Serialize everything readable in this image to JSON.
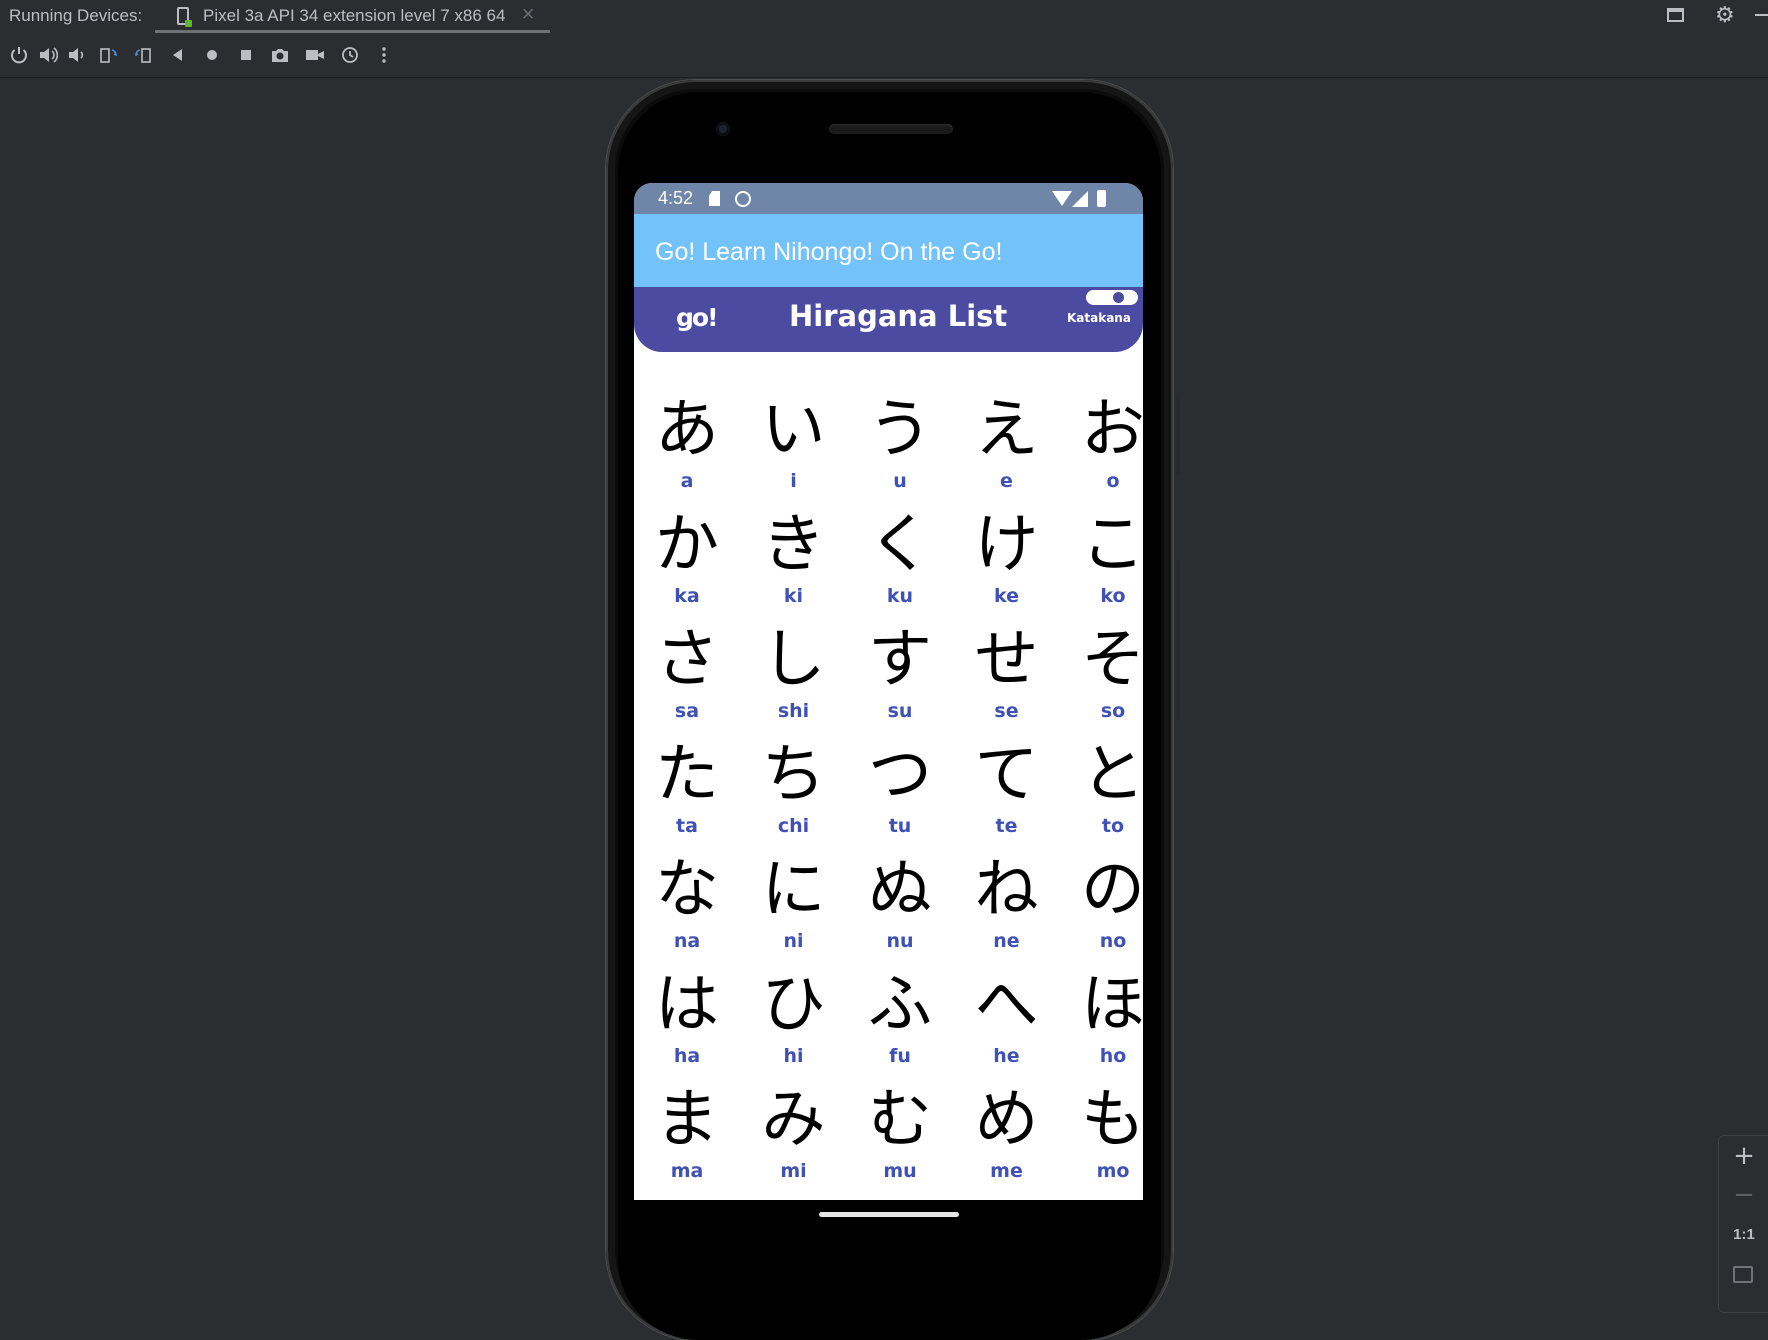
{
  "ide": {
    "running_label": "Running Devices:",
    "device_tab": "Pixel 3a API 34 extension level 7 x86 64",
    "tab_close": "×",
    "toolbar_icons": [
      "power-icon",
      "volume-up-icon",
      "volume-down-icon",
      "rotate-left-icon",
      "rotate-right-icon",
      "back-icon",
      "home-icon",
      "overview-icon",
      "screenshot-icon",
      "screen-record-icon",
      "snapshot-icon",
      "more-icon"
    ]
  },
  "status": {
    "time": "4:52"
  },
  "app": {
    "title": "Go! Learn Nihongo! On the Go!",
    "logo": "go!",
    "header_title": "Hiragana List",
    "toggle_label": "Katakana"
  },
  "kana": [
    [
      {
        "char": "あ",
        "roma": "a"
      },
      {
        "char": "い",
        "roma": "i"
      },
      {
        "char": "う",
        "roma": "u"
      },
      {
        "char": "え",
        "roma": "e"
      },
      {
        "char": "お",
        "roma": "o"
      }
    ],
    [
      {
        "char": "か",
        "roma": "ka"
      },
      {
        "char": "き",
        "roma": "ki"
      },
      {
        "char": "く",
        "roma": "ku"
      },
      {
        "char": "け",
        "roma": "ke"
      },
      {
        "char": "こ",
        "roma": "ko"
      }
    ],
    [
      {
        "char": "さ",
        "roma": "sa"
      },
      {
        "char": "し",
        "roma": "shi"
      },
      {
        "char": "す",
        "roma": "su"
      },
      {
        "char": "せ",
        "roma": "se"
      },
      {
        "char": "そ",
        "roma": "so"
      }
    ],
    [
      {
        "char": "た",
        "roma": "ta"
      },
      {
        "char": "ち",
        "roma": "chi"
      },
      {
        "char": "つ",
        "roma": "tu"
      },
      {
        "char": "て",
        "roma": "te"
      },
      {
        "char": "と",
        "roma": "to"
      }
    ],
    [
      {
        "char": "な",
        "roma": "na"
      },
      {
        "char": "に",
        "roma": "ni"
      },
      {
        "char": "ぬ",
        "roma": "nu"
      },
      {
        "char": "ね",
        "roma": "ne"
      },
      {
        "char": "の",
        "roma": "no"
      }
    ],
    [
      {
        "char": "は",
        "roma": "ha"
      },
      {
        "char": "ひ",
        "roma": "hi"
      },
      {
        "char": "ふ",
        "roma": "fu"
      },
      {
        "char": "へ",
        "roma": "he"
      },
      {
        "char": "ほ",
        "roma": "ho"
      }
    ],
    [
      {
        "char": "ま",
        "roma": "ma"
      },
      {
        "char": "み",
        "roma": "mi"
      },
      {
        "char": "む",
        "roma": "mu"
      },
      {
        "char": "め",
        "roma": "me"
      },
      {
        "char": "も",
        "roma": "mo"
      }
    ]
  ],
  "zoom": {
    "plus": "+",
    "minus": "−",
    "actual": "1:1"
  },
  "colors": {
    "ide_bg": "#2b2d30",
    "status_bar": "#7086a8",
    "app_bar": "#74c2fa",
    "header_bar": "#4b4ba2",
    "romaji": "#3f51b5"
  }
}
